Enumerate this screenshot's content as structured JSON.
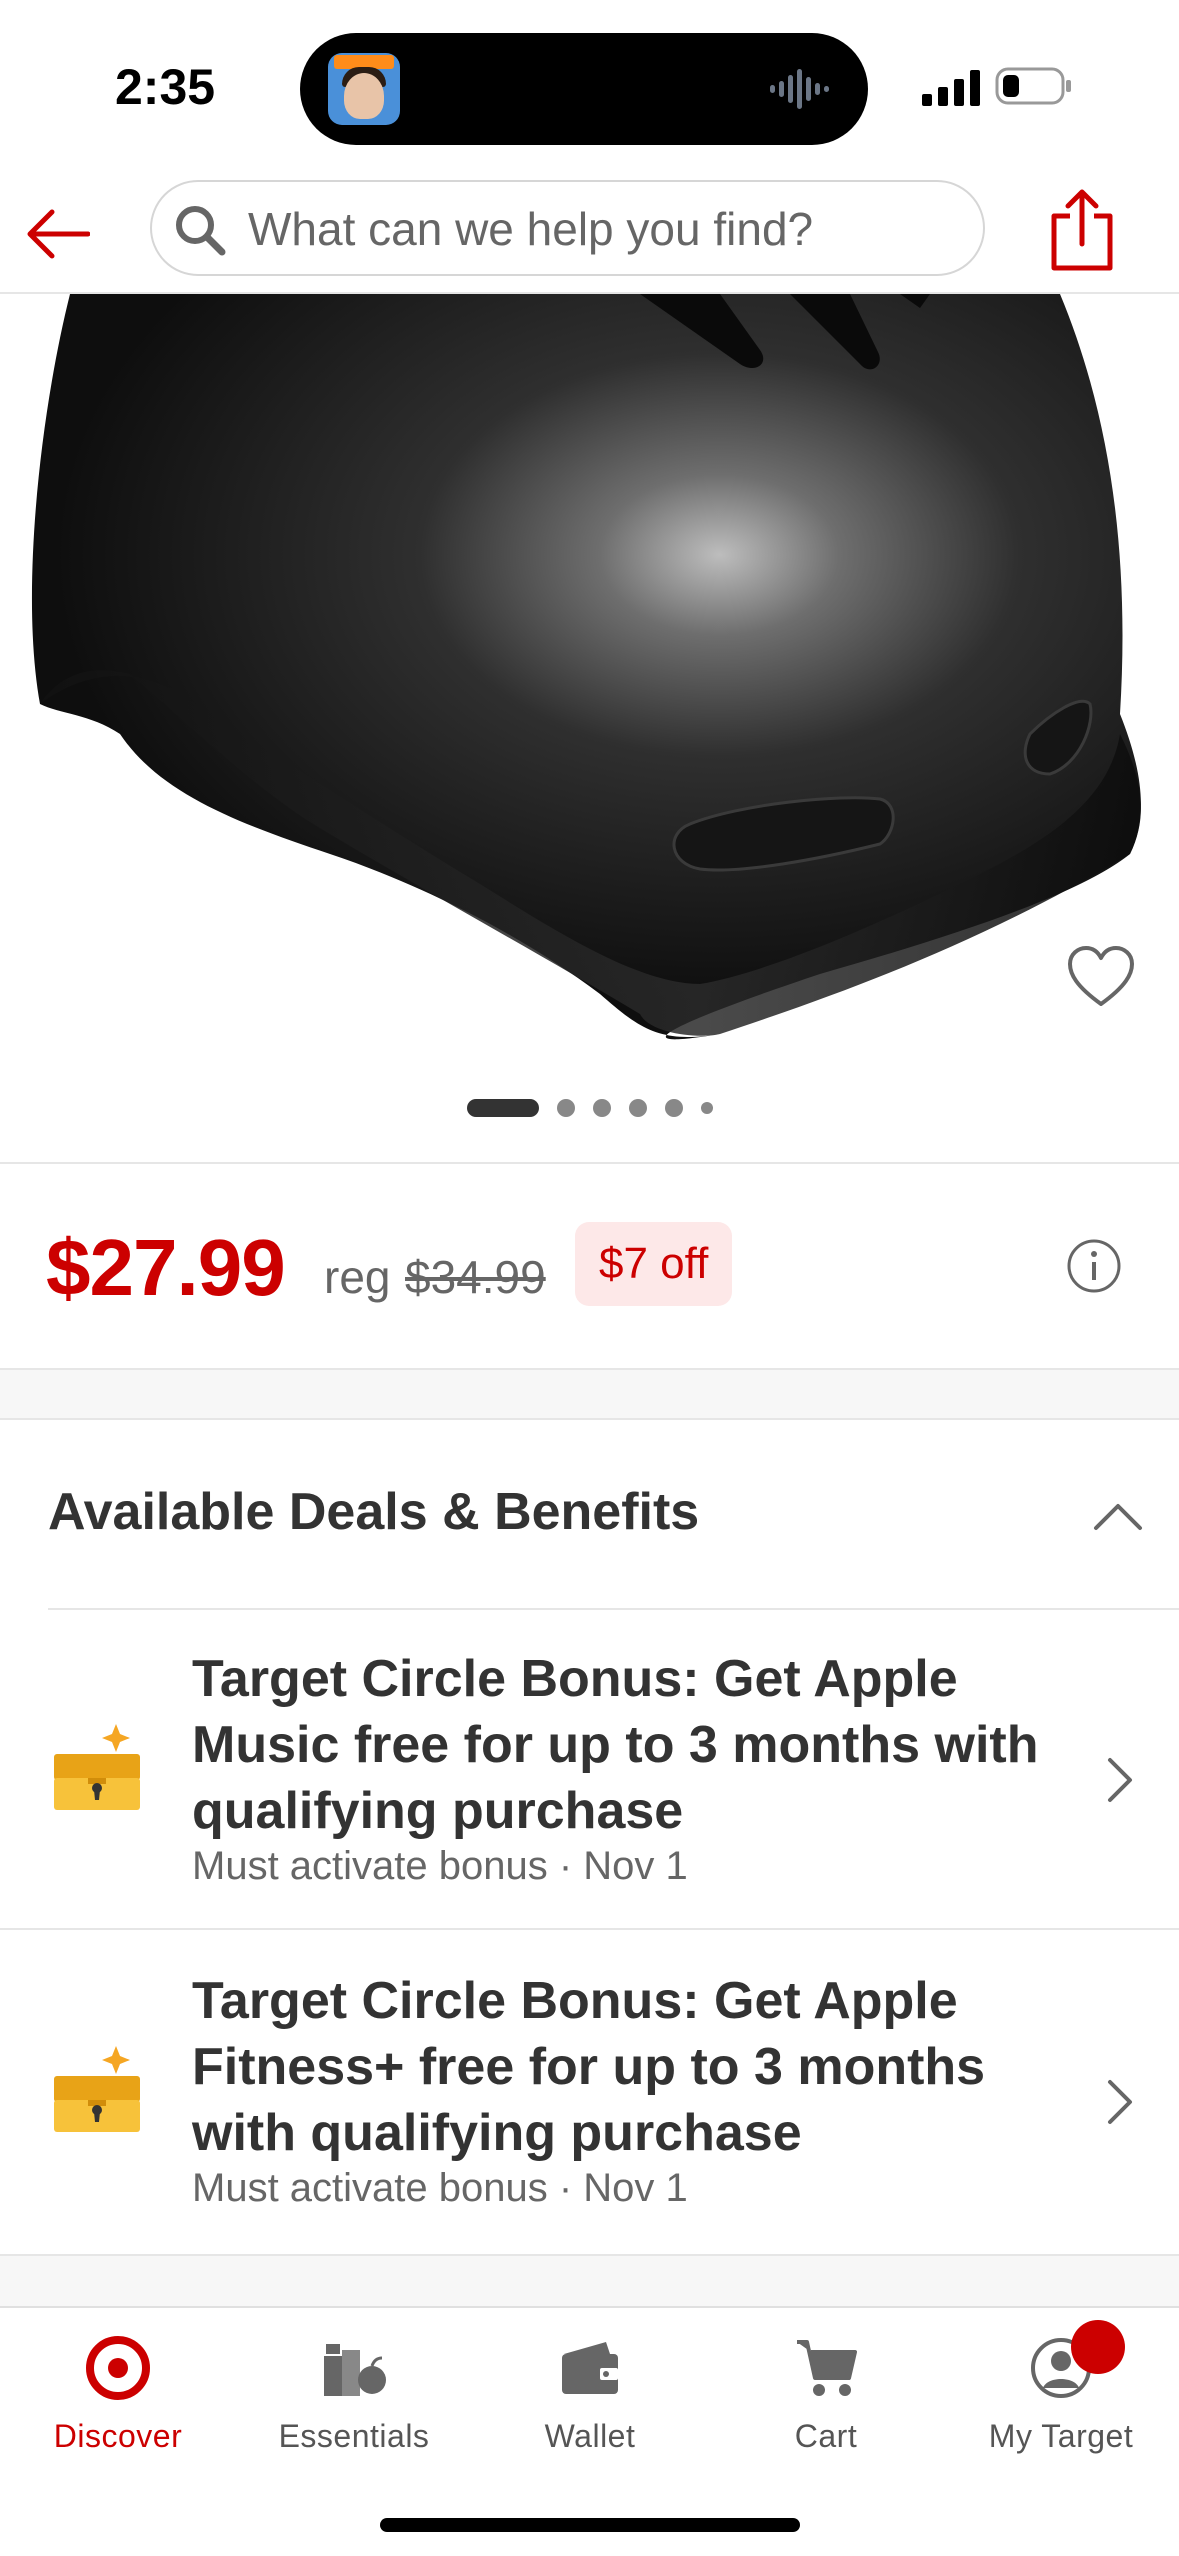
{
  "status_bar": {
    "time": "2:35"
  },
  "header": {
    "search_placeholder": "What can we help you find?",
    "back_icon": "arrow-left-icon",
    "share_icon": "share-icon",
    "accent_color": "#cc0000"
  },
  "product": {
    "image_description_icon": "helmet-image",
    "carousel": {
      "total_dots": 6,
      "active_index": 0
    }
  },
  "price": {
    "current": "$27.99",
    "reg_label": "reg",
    "reg_value": "$34.99",
    "discount": "$7 off"
  },
  "deals": {
    "title": "Available Deals & Benefits",
    "items": [
      {
        "title": "Target Circle Bonus: Get Apple Music free for up to 3 months with qualifying purchase",
        "subtitle": "Must activate bonus · Nov 1",
        "icon": "treasure-chest-icon"
      },
      {
        "title": "Target Circle Bonus: Get Apple Fitness+ free for up to 3 months with qualifying purchase",
        "subtitle": "Must activate bonus · Nov 1",
        "icon": "treasure-chest-icon"
      }
    ]
  },
  "tab_bar": {
    "tabs": [
      {
        "label": "Discover",
        "icon": "bullseye-icon",
        "active": true
      },
      {
        "label": "Essentials",
        "icon": "essentials-icon",
        "active": false
      },
      {
        "label": "Wallet",
        "icon": "wallet-icon",
        "active": false
      },
      {
        "label": "Cart",
        "icon": "cart-icon",
        "active": false
      },
      {
        "label": "My Target",
        "icon": "profile-icon",
        "active": false
      }
    ]
  }
}
